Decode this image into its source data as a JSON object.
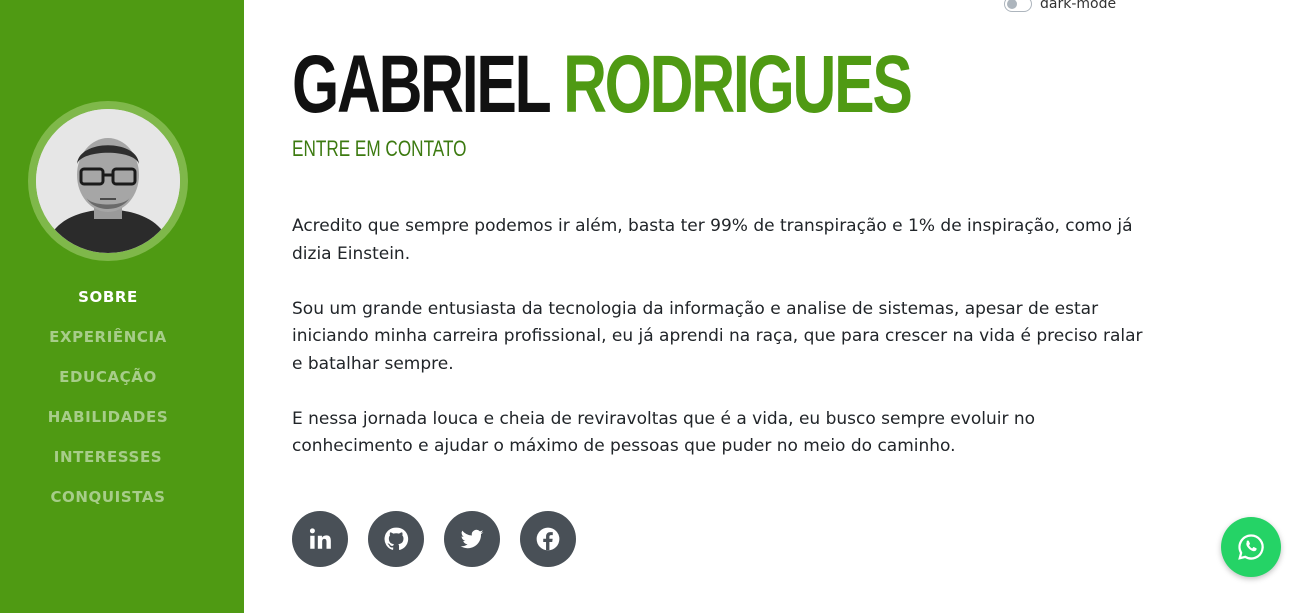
{
  "sidebar": {
    "nav": [
      "SOBRE",
      "EXPERIÊNCIA",
      "EDUCAÇÃO",
      "HABILIDADES",
      "INTERESSES",
      "CONQUISTAS"
    ],
    "active": "SOBRE"
  },
  "toggle": {
    "label": "dark-mode",
    "checked": false
  },
  "header": {
    "first_name": "GABRIEL",
    "last_name": "RODRIGUES",
    "subheading": "ENTRE EM CONTATO"
  },
  "about": {
    "paragraphs": [
      "Acredito que sempre podemos ir além, basta ter 99% de transpiração e 1% de inspiração, como já dizia Einstein.",
      "Sou um grande entusiasta da tecnologia da informação e analise de sistemas, apesar de estar iniciando minha carreira profissional, eu já aprendi na raça, que para crescer na vida é preciso ralar e batalhar sempre.",
      "E nessa jornada louca e cheia de reviravoltas que é a vida, eu busco sempre evoluir no conhecimento e ajudar o máximo de pessoas que puder no meio do caminho."
    ]
  },
  "social_icons": [
    "linkedin-icon",
    "github-icon",
    "twitter-icon",
    "facebook-icon"
  ],
  "floating": {
    "icon": "whatsapp-icon"
  },
  "colors": {
    "sidebar": "#4f9a13",
    "accent": "#4f9a13",
    "social_bg": "#495057",
    "whatsapp": "#25d366"
  }
}
